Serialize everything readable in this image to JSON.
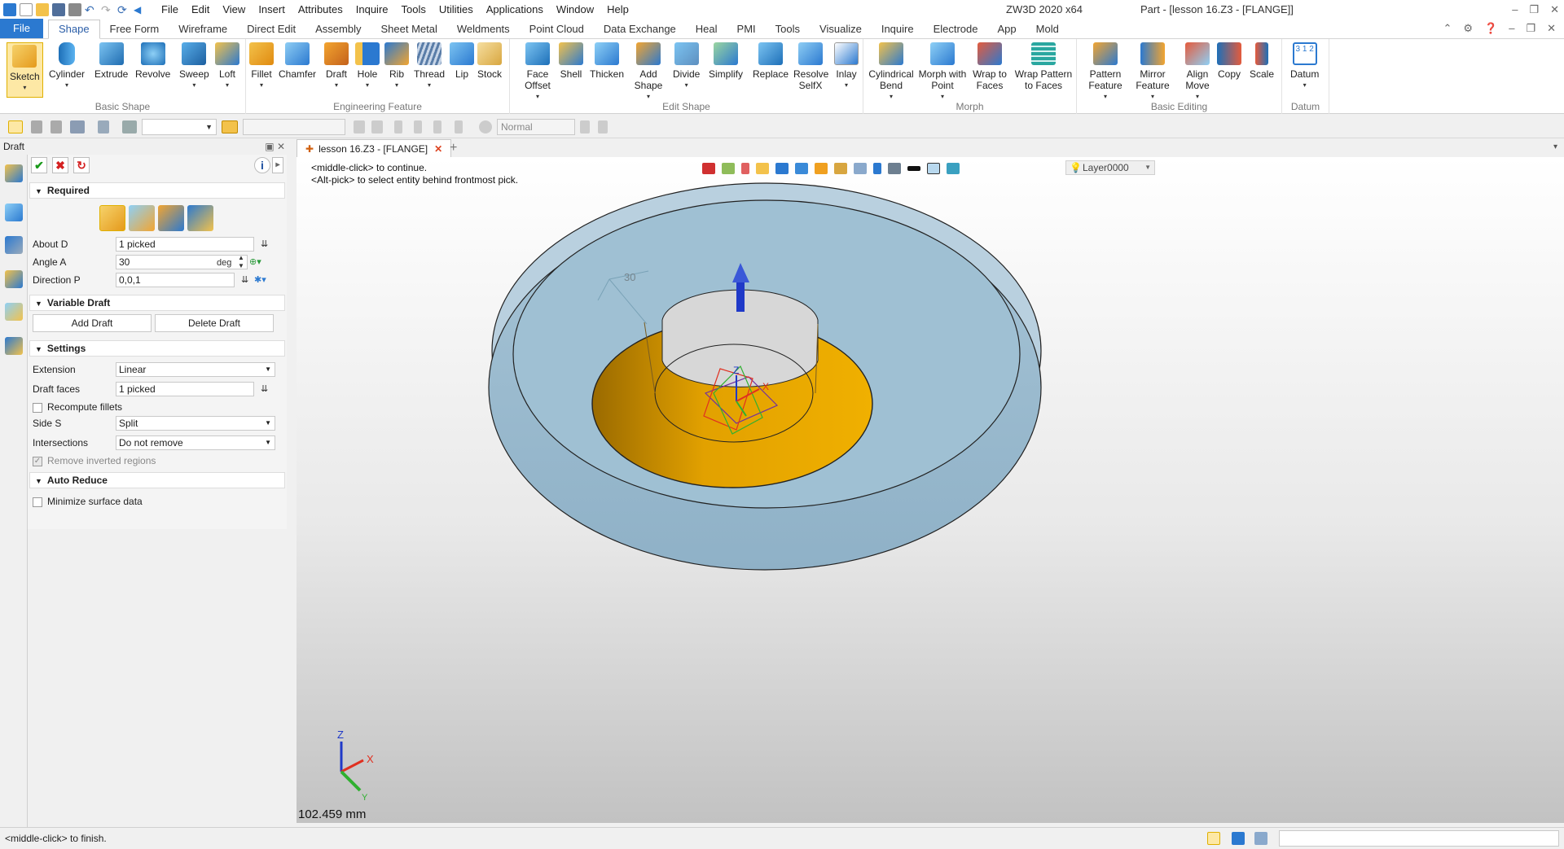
{
  "titlebar": {
    "menu": [
      "File",
      "Edit",
      "View",
      "Insert",
      "Attributes",
      "Inquire",
      "Tools",
      "Utilities",
      "Applications",
      "Window",
      "Help"
    ],
    "app_name": "ZW3D 2020 x64",
    "doc_title": "Part - [lesson 16.Z3 - [FLANGE]]"
  },
  "ribbon_tabs": [
    "File",
    "Shape",
    "Free Form",
    "Wireframe",
    "Direct Edit",
    "Assembly",
    "Sheet Metal",
    "Weldments",
    "Point Cloud",
    "Data Exchange",
    "Heal",
    "PMI",
    "Tools",
    "Visualize",
    "Inquire",
    "Electrode",
    "App",
    "Mold"
  ],
  "ribbon": {
    "groups": [
      {
        "name": "Basic Shape",
        "buttons": [
          "Sketch",
          "Cylinder",
          "Extrude",
          "Revolve",
          "Sweep",
          "Loft"
        ]
      },
      {
        "name": "Engineering Feature",
        "buttons": [
          "Fillet",
          "Chamfer",
          "Draft",
          "Hole",
          "Rib",
          "Thread",
          "Lip",
          "Stock"
        ]
      },
      {
        "name": "Edit Shape",
        "buttons": [
          "Face Offset",
          "Shell",
          "Thicken",
          "Add Shape",
          "Divide",
          "Simplify",
          "Replace",
          "Resolve SelfX",
          "Inlay"
        ]
      },
      {
        "name": "Morph",
        "buttons": [
          "Cylindrical Bend",
          "Morph with Point",
          "Wrap to Faces",
          "Wrap Pattern to Faces"
        ]
      },
      {
        "name": "Basic Editing",
        "buttons": [
          "Pattern Feature",
          "Mirror Feature",
          "Align Move",
          "Copy",
          "Scale"
        ]
      },
      {
        "name": "Datum",
        "buttons": [
          "Datum"
        ]
      }
    ],
    "colors": {
      "accent": "#2b79d0",
      "selected": "#fde8a5",
      "icon_blue": "#2f8fd8",
      "icon_orange": "#f0a020"
    }
  },
  "toolbar2": {
    "style_value": "Normal"
  },
  "panel": {
    "title": "Draft",
    "required": {
      "header": "Required",
      "about_label": "About D",
      "about_value": "1 picked",
      "angle_label": "Angle A",
      "angle_value": "30",
      "angle_unit": "deg",
      "direction_label": "Direction P",
      "direction_value": "0,0,1"
    },
    "variable": {
      "header": "Variable Draft",
      "add": "Add Draft",
      "delete": "Delete Draft"
    },
    "settings": {
      "header": "Settings",
      "extension_label": "Extension",
      "extension_value": "Linear",
      "draft_faces_label": "Draft faces",
      "draft_faces_value": "1 picked",
      "recompute_label": "Recompute fillets",
      "side_label": "Side S",
      "side_value": "Split",
      "intersections_label": "Intersections",
      "intersections_value": "Do not remove",
      "remove_inverted_label": "Remove inverted regions"
    },
    "auto_reduce": {
      "header": "Auto Reduce",
      "minimize_label": "Minimize surface data"
    }
  },
  "doc_tab": {
    "label": "lesson 16.Z3 - [FLANGE]"
  },
  "viewport": {
    "hint1": "<middle-click> to continue.",
    "hint2": "<Alt-pick> to select entity behind frontmost pick.",
    "layer": "Layer0000",
    "distance": "102.459 mm",
    "angle_annot": "30",
    "axis_x": "X",
    "axis_z": "Z",
    "axis_y": "Y"
  },
  "status": {
    "text": "<middle-click> to finish."
  }
}
